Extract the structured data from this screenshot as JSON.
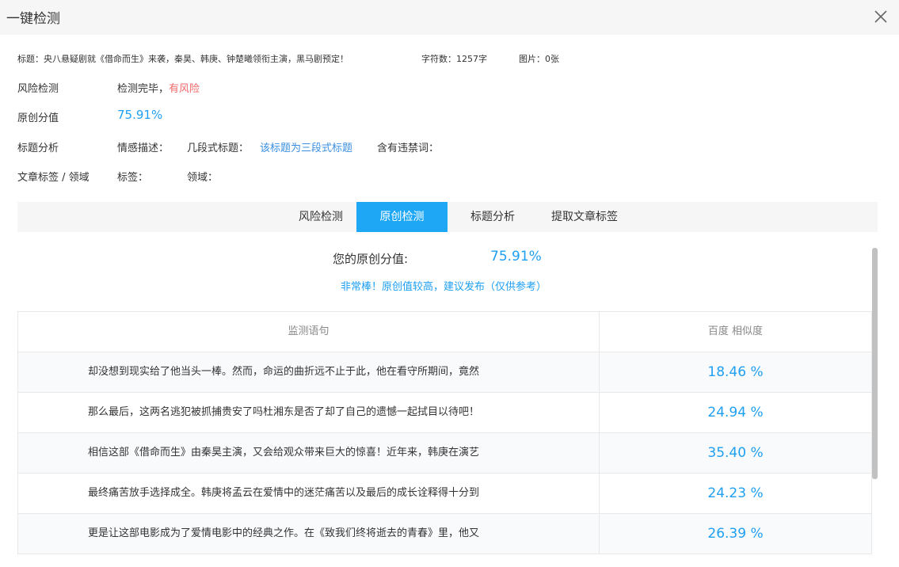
{
  "dialog": {
    "title": "一键检测",
    "close_icon": "close-icon"
  },
  "info": {
    "title_text": "标题：央八悬疑剧就《借命而生》来袭，秦昊、韩庚、钟楚曦领衔主演，黑马剧预定！",
    "char_count": "字符数：1257字",
    "image_count": "图片：0张"
  },
  "rows": {
    "risk": {
      "label": "风险检测",
      "status": "检测完毕，",
      "result": "有风险"
    },
    "original": {
      "label": "原创分值",
      "value": "75.91%"
    },
    "title_analysis": {
      "label": "标题分析",
      "emotion": "情感描述：",
      "segment_label": "几段式标题：",
      "segment_value": "该标题为三段式标题",
      "forbidden": "含有违禁词："
    },
    "tags": {
      "label": "文章标签 / 领域",
      "tag_label": "标签：",
      "domain_label": "领域："
    }
  },
  "tabs": [
    {
      "label": "风险检测",
      "active": false
    },
    {
      "label": "原创检测",
      "active": true
    },
    {
      "label": "标题分析",
      "active": false
    },
    {
      "label": "提取文章标签",
      "active": false
    }
  ],
  "summary": {
    "label": "您的原创分值:",
    "value": "75.91%",
    "note": "非常棒！原创值较高，建议发布（仅供参考）"
  },
  "table": {
    "headers": [
      "监测语句",
      "百度 相似度"
    ],
    "rows": [
      {
        "sentence": "却没想到现实给了他当头一棒。然而，命运的曲折远不止于此，他在看守所期间，竟然",
        "similarity": "18.46 %"
      },
      {
        "sentence": "那么最后，这两名逃犯被抓捕贵安了吗杜湘东是否了却了自己的遗憾一起拭目以待吧！",
        "similarity": "24.94 %"
      },
      {
        "sentence": "相信这部《借命而生》由秦昊主演，又会给观众带来巨大的惊喜！近年来，韩庚在演艺",
        "similarity": "35.40 %"
      },
      {
        "sentence": "最终痛苦放手选择成全。韩庚将孟云在爱情中的迷茫痛苦以及最后的成长诠释得十分到",
        "similarity": "24.23 %"
      },
      {
        "sentence": "更是让这部电影成为了爱情电影中的经典之作。在《致我们终将逝去的青春》里，他又",
        "similarity": "26.39 %"
      }
    ]
  },
  "colors": {
    "accent": "#1ea7f5",
    "risk": "#f06a6a",
    "score": "#1e9ff2"
  }
}
